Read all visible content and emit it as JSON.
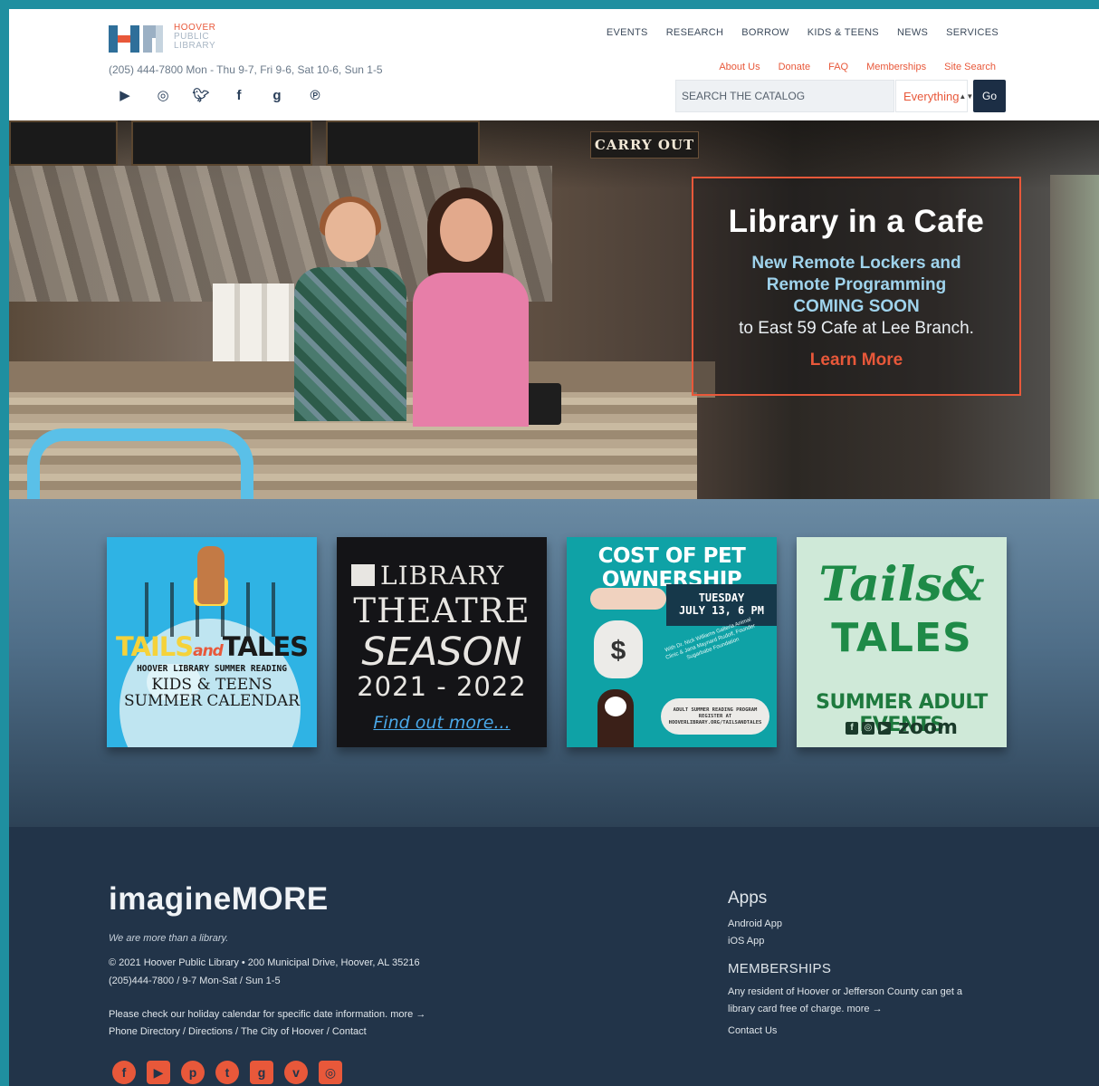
{
  "header": {
    "logo_name": "HOOVER",
    "logo_sub1": "PUBLIC",
    "logo_sub2": "LIBRARY",
    "hours": "(205) 444-7800 Mon - Thu 9-7, Fri 9-6, Sat 10-6, Sun 1-5",
    "social_icons": [
      "youtube-icon",
      "instagram-icon",
      "twitter-icon",
      "facebook-icon",
      "goodreads-icon",
      "pinterest-icon"
    ],
    "main_nav": [
      "EVENTS",
      "RESEARCH",
      "BORROW",
      "KIDS & TEENS",
      "NEWS",
      "SERVICES"
    ],
    "util_nav": [
      "About Us",
      "Donate",
      "FAQ",
      "Memberships",
      "Site Search"
    ],
    "search": {
      "placeholder": "SEARCH THE CATALOG",
      "scope": "Everything",
      "go_label": "Go"
    }
  },
  "hero": {
    "sign": "CARRY OUT",
    "title": "Library in a Cafe",
    "line1": "New Remote Lockers and",
    "line2": "Remote Programming",
    "line3": "COMING SOON",
    "line4": "to East 59 Cafe at Lee Branch.",
    "cta": "Learn More"
  },
  "promos": {
    "p1": {
      "w1": "TAILS",
      "w2": "and",
      "w3": "TALES",
      "sub1": "HOOVER LIBRARY SUMMER READING",
      "sub2a": "KIDS & TEENS",
      "sub2b": "SUMMER CALENDAR"
    },
    "p2": {
      "l1": "LIBRARY",
      "l2": "THEATRE",
      "l3": "SEASON",
      "l4": "2021 - 2022",
      "l5": "Find out more..."
    },
    "p3": {
      "title": "COST OF PET OWNERSHIP",
      "day": "TUESDAY",
      "date": "JULY 13, 6 PM",
      "symbol": "$",
      "small": "With Dr. Nick Williams Galleria Animal Clinic & Jana Maynard Rudolf, Founder Sugarbabe Foundation",
      "bone1": "ADULT SUMMER READING PROGRAM",
      "bone2": "REGISTER AT",
      "bone3": "HOOVERLIBRARY.ORG/TAILSANDTALES"
    },
    "p4": {
      "l1": "Tails&",
      "l2": "TALES",
      "l3": "SUMMER ADULT EVENTS",
      "zoom": "zoom"
    }
  },
  "footer": {
    "brand": "imagineMORE",
    "tagline": "We are more than a library.",
    "copyright": "© 2021 Hoover Public Library • 200 Municipal Drive, Hoover, AL 35216",
    "contact": "(205)444-7800  / 9-7 Mon-Sat  /  Sun 1-5",
    "holiday": "Please check our holiday calendar for specific date information. more →",
    "links": [
      "Phone Directory",
      "Directions",
      "The City of Hoover",
      "Contact"
    ],
    "apps_title": "Apps",
    "apps": [
      "Android App",
      "iOS App"
    ],
    "memberships_title": "MEMBERSHIPS",
    "memberships_text": "Any resident of Hoover or Jefferson County can get a library card free of charge. more →",
    "contact_us": "Contact Us",
    "social_icons": [
      "facebook-icon",
      "youtube-icon",
      "pinterest-icon",
      "twitter-icon",
      "goodreads-icon",
      "vimeo-icon",
      "instagram-icon"
    ]
  },
  "colors": {
    "accent": "#e8583a",
    "navy": "#1c2e45",
    "footer_bg": "#223449",
    "frame": "#1f8fa0"
  }
}
